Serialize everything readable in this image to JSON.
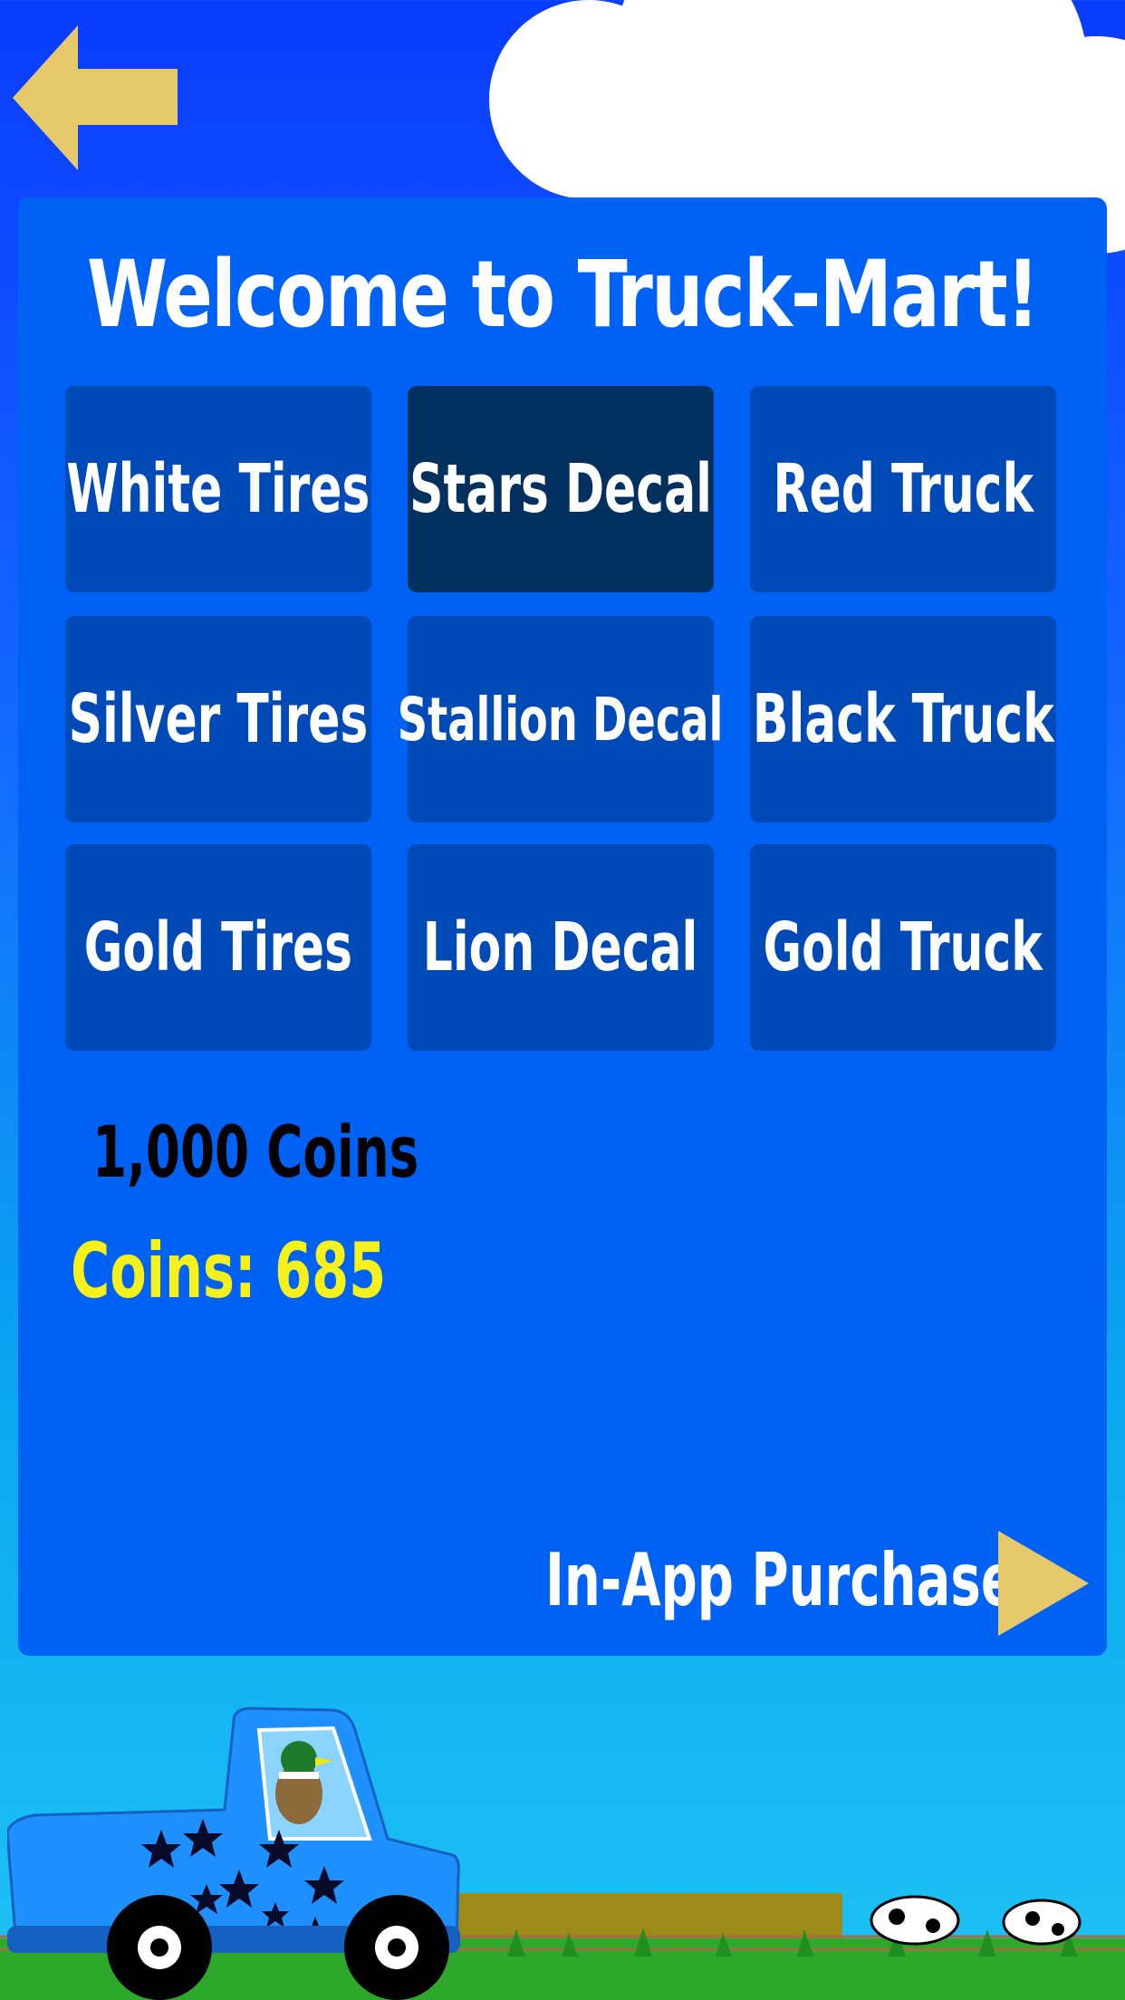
{
  "nav": {
    "back_icon": "left-arrow-icon"
  },
  "shop": {
    "title": "Welcome to Truck-Mart!",
    "items": [
      {
        "label": "White Tires",
        "selected": false
      },
      {
        "label": "Stars Decal",
        "selected": true
      },
      {
        "label": "Red Truck",
        "selected": false
      },
      {
        "label": "Silver Tires",
        "selected": false
      },
      {
        "label": "Stallion Decal",
        "selected": false
      },
      {
        "label": "Black Truck",
        "selected": false
      },
      {
        "label": "Gold Tires",
        "selected": false
      },
      {
        "label": "Lion Decal",
        "selected": false
      },
      {
        "label": "Gold Truck",
        "selected": false
      }
    ],
    "price": "1,000 Coins",
    "coins": "Coins:  685",
    "iap_label": "In-App Purchases",
    "iap_icon": "play-arrow-icon"
  },
  "colors": {
    "panel": "#0062f5",
    "tile": "#004ab8",
    "tile_selected": "#02305f",
    "arrow": "#e6c96b",
    "coins_text": "#f6f219"
  }
}
